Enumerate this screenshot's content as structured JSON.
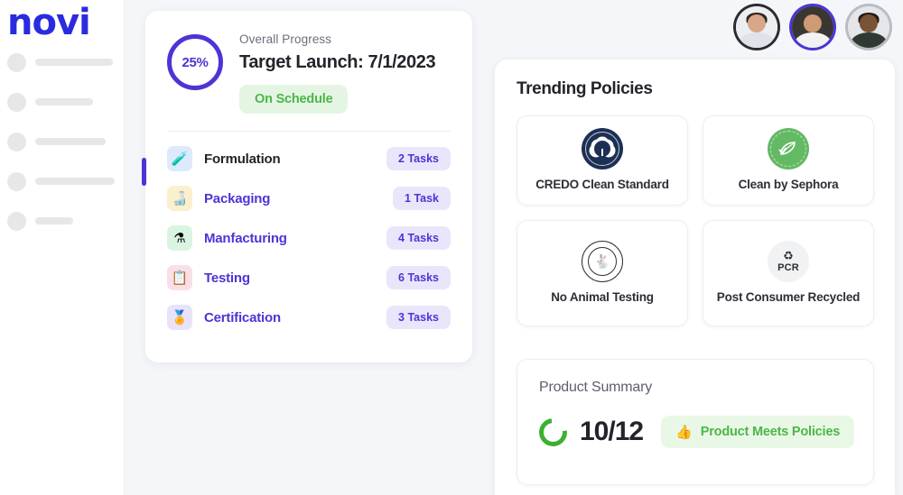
{
  "sidebar": {
    "logo": "novi",
    "skeleton_items": [
      {
        "width": 86
      },
      {
        "width": 64
      },
      {
        "width": 78
      },
      {
        "width": 88
      },
      {
        "width": 42
      }
    ]
  },
  "header": {
    "avatars": [
      {
        "name": "avatar-user-1",
        "ring": "dark",
        "skin": "#d8a78a",
        "hair": "#2e2721",
        "shirt": "#dfe2e8"
      },
      {
        "name": "avatar-user-2",
        "ring": "accent",
        "skin": "#cf9a74",
        "hair": "#3b3631",
        "shirt": "#f2f2f2"
      },
      {
        "name": "avatar-user-3",
        "ring": "gray",
        "skin": "#7a5236",
        "hair": "#241a14",
        "shirt": "#2f3a33"
      }
    ]
  },
  "progress_card": {
    "percent_label": "25%",
    "overall_progress_label": "Overall Progress",
    "target_launch": "Target Launch: 7/1/2023",
    "status": "On Schedule",
    "accent_color": "#4b35d6",
    "status_color": "#4cb648",
    "tasks": [
      {
        "icon": "test-tube-icon",
        "glyph": "🧪",
        "tile_bg": "#dceafb",
        "label": "Formulation",
        "badge": "2 Tasks",
        "style": "plain"
      },
      {
        "icon": "bottle-icon",
        "glyph": "🍶",
        "tile_bg": "#fcf0cc",
        "label": "Packaging",
        "badge": "1 Task",
        "style": "linky"
      },
      {
        "icon": "flask-icon",
        "glyph": "⚗",
        "tile_bg": "#d9f5e2",
        "label": "Manfacturing",
        "badge": "4 Tasks",
        "style": "linky"
      },
      {
        "icon": "clipboard-icon",
        "glyph": "📋",
        "tile_bg": "#fbdfe6",
        "label": "Testing",
        "badge": "6 Tasks",
        "style": "linky"
      },
      {
        "icon": "award-ribbon-icon",
        "glyph": "🎖",
        "tile_bg": "#e9e3fa",
        "label": "Certification",
        "badge": "3 Tasks",
        "style": "linky"
      }
    ]
  },
  "trending_policies": {
    "title": "Trending Policies",
    "cards": [
      {
        "seal": "credo-seal-icon",
        "label": "CREDO Clean Standard"
      },
      {
        "seal": "sephora-leaf-seal-icon",
        "label": "Clean by Sephora"
      },
      {
        "seal": "no-animal-testing-seal-icon",
        "label": "No Animal Testing"
      },
      {
        "seal": "pcr-recycle-seal-icon",
        "label": "Post Consumer Recycled",
        "pcr_text": "PCR"
      }
    ]
  },
  "product_summary": {
    "title": "Product Summary",
    "count": "10/12",
    "badge_text": "Product Meets Policies",
    "badge_icon": "thumbs-up-icon",
    "badge_glyph": "👍",
    "ring_color": "#3cb032"
  }
}
